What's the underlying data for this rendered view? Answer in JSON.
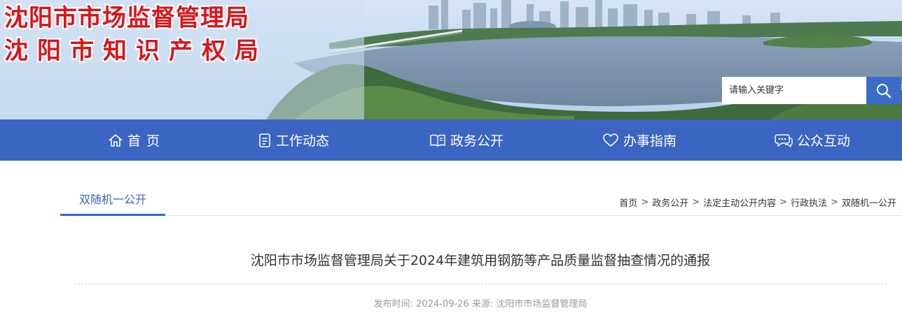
{
  "header": {
    "title_line1": "沈阳市市场监督管理局",
    "title_line2": "沈阳市知识产权局",
    "search_placeholder": "请输入关键字",
    "search_icon": "search-icon"
  },
  "nav": {
    "items": [
      {
        "label": "首页",
        "icon": "home-icon"
      },
      {
        "label": "工作动态",
        "icon": "document-icon"
      },
      {
        "label": "政务公开",
        "icon": "book-icon"
      },
      {
        "label": "办事指南",
        "icon": "heart-icon"
      },
      {
        "label": "公众互动",
        "icon": "chat-icon"
      }
    ]
  },
  "section": {
    "tab_label": "双随机一公开"
  },
  "breadcrumb": {
    "items": [
      "首页",
      "政务公开",
      "法定主动公开内容",
      "行政执法",
      "双随机一公开"
    ],
    "separator": ">"
  },
  "article": {
    "title": "沈阳市市场监督管理局关于2024年建筑用钢筋等产品质量监督抽查情况的通报",
    "meta": "发布时间: 2024-09-26 来源: 沈阳市市场监督管理局"
  },
  "colors": {
    "brand_blue": "#3a65c2",
    "title_red": "#d9151b"
  }
}
